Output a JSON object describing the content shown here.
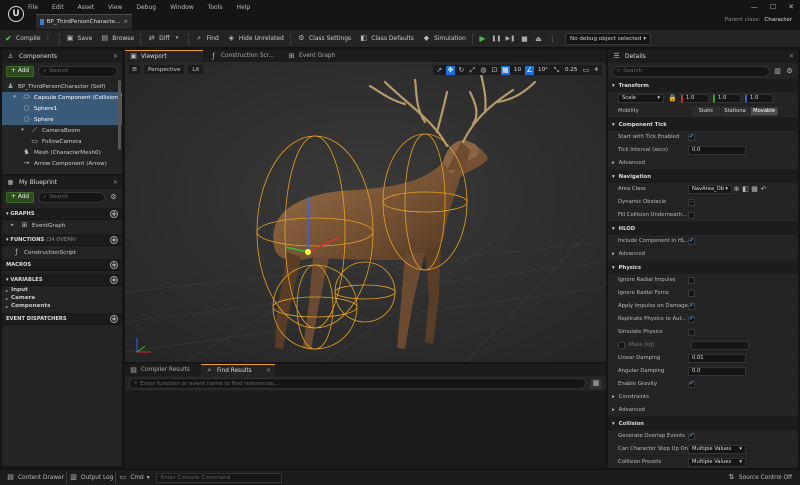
{
  "menu": [
    "File",
    "Edit",
    "Asset",
    "View",
    "Debug",
    "Window",
    "Tools",
    "Help"
  ],
  "document_tab": "BP_ThirdPersonCharacte...",
  "parent_class": {
    "label": "Parent class:",
    "value": "Character"
  },
  "toolbar": {
    "compile": "Compile",
    "save": "Save",
    "browse": "Browse",
    "diff": "Diff",
    "find": "Find",
    "hide_unrelated": "Hide Unrelated",
    "class_settings": "Class Settings",
    "class_defaults": "Class Defaults",
    "simulation": "Simulation",
    "debug_object": "No debug object selected"
  },
  "components": {
    "title": "Components",
    "add": "Add",
    "search_placeholder": "Search",
    "items": [
      {
        "label": "BP_ThirdPersonCharacter (Self)"
      },
      {
        "label": "Capsule Component (CollisionC"
      },
      {
        "label": "Sphere1"
      },
      {
        "label": "Sphere"
      },
      {
        "label": "CameraBoom"
      },
      {
        "label": "FollowCamera"
      },
      {
        "label": "Mesh (CharacterMesh0)"
      },
      {
        "label": "Arrow Component (Arrow)"
      }
    ]
  },
  "blueprint": {
    "title": "My Blueprint",
    "add": "Add",
    "search_placeholder": "Search",
    "graphs": "GRAPHS",
    "event_graph": "EventGraph",
    "functions": "FUNCTIONS",
    "functions_count": "(34 OVERRI",
    "construction_script": "ConstructionScript",
    "macros": "MACROS",
    "variables": "VARIABLES",
    "var_items": [
      "Input",
      "Camera",
      "Components"
    ],
    "event_dispatchers": "EVENT DISPATCHERS"
  },
  "tabs": {
    "viewport": "Viewport",
    "construction": "Construction Scr...",
    "event_graph": "Event Graph"
  },
  "viewport": {
    "perspective": "Perspective",
    "lit": "Lit",
    "grid": "10",
    "angle": "10°",
    "scale": "0.25",
    "cam": "4"
  },
  "bottom": {
    "compiler_results": "Compiler Results",
    "find_results": "Find Results",
    "find_placeholder": "Enter function or event name to find references..."
  },
  "details": {
    "title": "Details",
    "search_placeholder": "Search",
    "transform": "Transform",
    "scale_label": "Scale",
    "scale_values": [
      "1.0",
      "1.0",
      "1.0"
    ],
    "mobility": "Mobility",
    "mobility_options": [
      "Static",
      "Stationa",
      "Movable"
    ],
    "component_tick": "Component Tick",
    "start_tick": "Start with Tick Enabled",
    "tick_interval": "Tick Interval (secs)",
    "tick_interval_value": "0.0",
    "advanced": "Advanced",
    "navigation": "Navigation",
    "area_class": "Area Class",
    "area_class_value": "NavArea_Ob",
    "dynamic_obstacle": "Dynamic Obstacle",
    "fill_collision": "Fill Collision Underneath...",
    "hlod": "HLOD",
    "include_hlod": "Include Component in HL...",
    "physics": "Physics",
    "ignore_radial_impulse": "Ignore Radial Impulse",
    "ignore_radial_force": "Ignore Radial Force",
    "apply_impulse": "Apply Impulse on Damage",
    "replicate_physics": "Replicate Physics to Aut...",
    "simulate_physics": "Simulate Physics",
    "mass": "Mass (kg)",
    "linear_damping": "Linear Damping",
    "linear_damping_value": "0.01",
    "angular_damping": "Angular Damping",
    "angular_damping_value": "0.0",
    "enable_gravity": "Enable Gravity",
    "constraints": "Constraints",
    "collision": "Collision",
    "generate_overlap": "Generate Overlap Events",
    "can_step_up": "Can Character Step Up On",
    "can_step_up_value": "Multiple Values",
    "collision_presets": "Collision Presets",
    "collision_presets_value": "Multiple Values"
  },
  "status": {
    "content_drawer": "Content Drawer",
    "output_log": "Output Log",
    "cmd": "Cmd",
    "console_placeholder": "Enter Console Command",
    "source_control": "Source Control Off"
  },
  "colors": {
    "accent": "#3a5a7a",
    "play": "#4cb848",
    "orange": "#e8a020"
  }
}
